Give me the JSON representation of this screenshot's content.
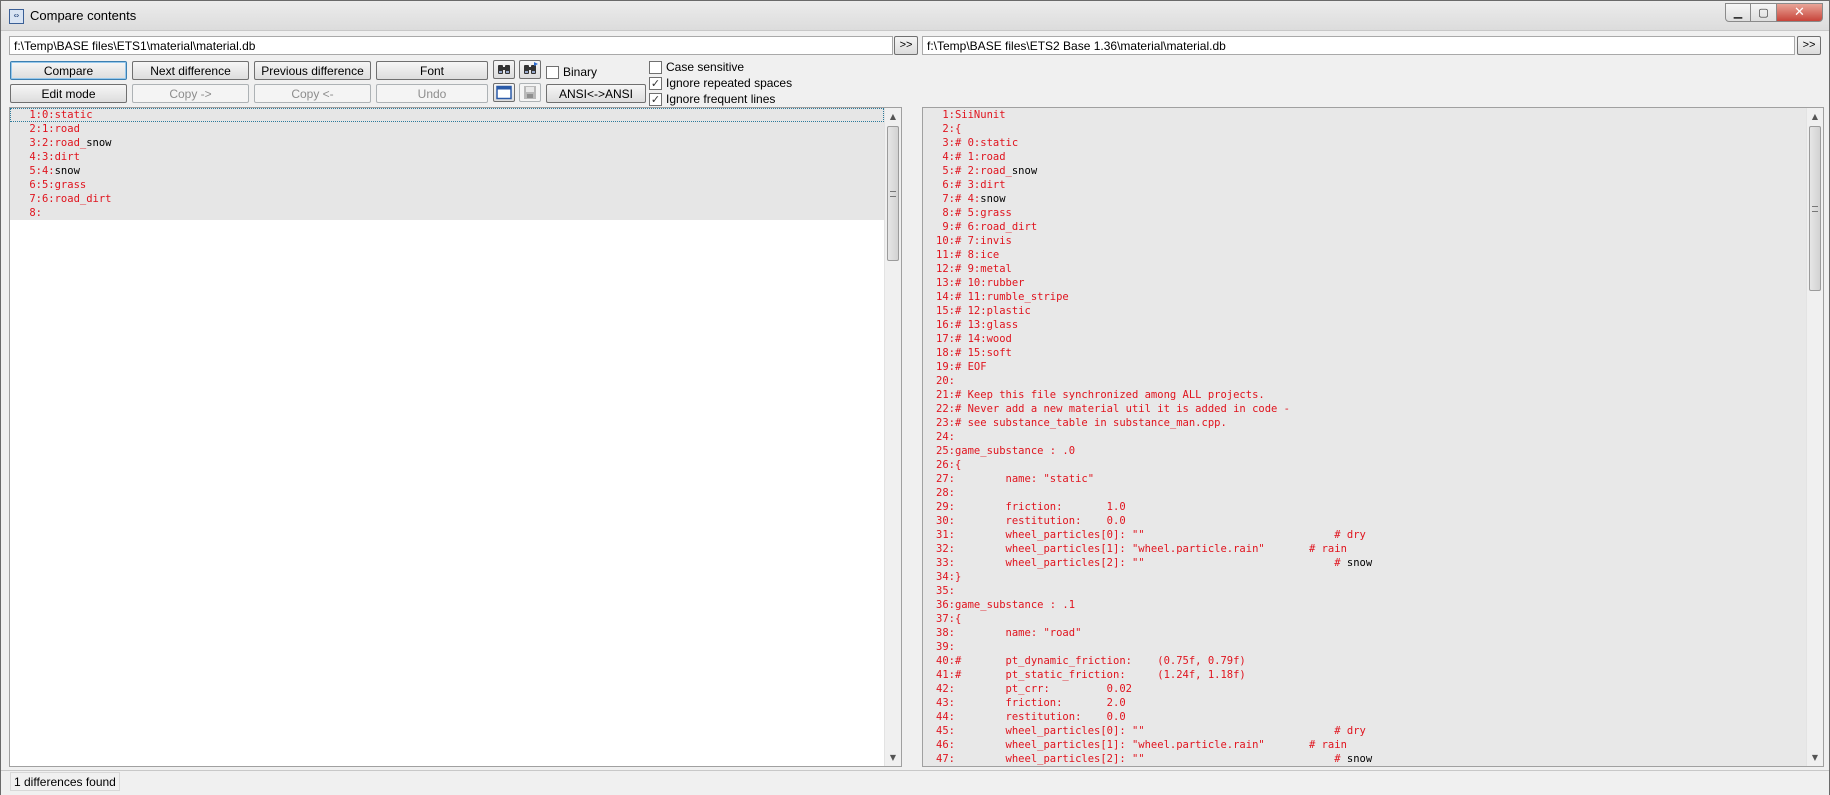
{
  "window": {
    "title": "Compare contents",
    "icon": "compare-window-icon"
  },
  "paths": {
    "left": "f:\\Temp\\BASE files\\ETS1\\material\\material.db",
    "right": "f:\\Temp\\BASE files\\ETS2 Base 1.36\\material\\material.db",
    "browse_label": ">>"
  },
  "toolbar": {
    "compare": "Compare",
    "next_difference": "Next difference",
    "previous_difference": "Previous difference",
    "font": "Font",
    "edit_mode": "Edit mode",
    "copy_right": "Copy ->",
    "copy_left": "Copy <-",
    "undo": "Undo",
    "ansi": "ANSI<->ANSI",
    "icons": [
      "find-icon",
      "find-next-icon",
      "layout-icon",
      "save-icon"
    ]
  },
  "options": {
    "binary": {
      "label": "Binary",
      "checked": false
    },
    "case_sensitive": {
      "label": "Case sensitive",
      "checked": false
    },
    "ignore_repeated_spaces": {
      "label": "Ignore repeated spaces",
      "checked": true
    },
    "ignore_frequent_lines": {
      "label": "Ignore frequent lines",
      "checked": true
    }
  },
  "left_lines": [
    " 1:0:static",
    " 2:1:road",
    " 3:2:road_snow",
    " 4:3:dirt",
    " 5:4:snow",
    " 6:5:grass",
    " 7:6:road_dirt",
    " 8:"
  ],
  "right_lines": [
    " 1:SiiNunit",
    " 2:{",
    " 3:# 0:static",
    " 4:# 1:road",
    " 5:# 2:road_snow",
    " 6:# 3:dirt",
    " 7:# 4:snow",
    " 8:# 5:grass",
    " 9:# 6:road_dirt",
    "10:# 7:invis",
    "11:# 8:ice",
    "12:# 9:metal",
    "13:# 10:rubber",
    "14:# 11:rumble_stripe",
    "15:# 12:plastic",
    "16:# 13:glass",
    "17:# 14:wood",
    "18:# 15:soft",
    "19:# EOF",
    "20:",
    "21:# Keep this file synchronized among ALL projects.",
    "22:# Never add a new material util it is added in code -",
    "23:# see substance_table in substance_man.cpp.",
    "24:",
    "25:game_substance : .0",
    "26:{",
    "27:        name: \"static\"",
    "28:",
    "29:        friction:       1.0",
    "30:        restitution:    0.0",
    "31:        wheel_particles[0]: \"\"                              # dry",
    "32:        wheel_particles[1]: \"wheel.particle.rain\"       # rain",
    "33:        wheel_particles[2]: \"\"                              # snow",
    "34:}",
    "35:",
    "36:game_substance : .1",
    "37:{",
    "38:        name: \"road\"",
    "39:",
    "40:#       pt_dynamic_friction:    (0.75f, 0.79f)",
    "41:#       pt_static_friction:     (1.24f, 1.18f)",
    "42:        pt_crr:         0.02",
    "43:        friction:       2.0",
    "44:        restitution:    0.0",
    "45:        wheel_particles[0]: \"\"                              # dry",
    "46:        wheel_particles[1]: \"wheel.particle.rain\"       # rain",
    "47:        wheel_particles[2]: \"\"                              # snow"
  ],
  "status": {
    "text": "1 differences found"
  }
}
